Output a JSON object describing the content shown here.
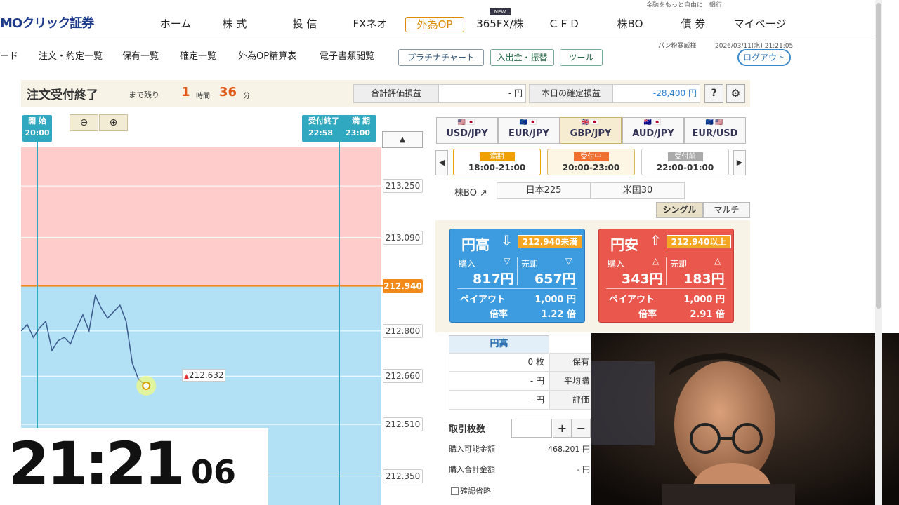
{
  "top_right_text": "金融をもっと自由に　銀行",
  "nav": {
    "logo": "MOクリック証券",
    "items": [
      "ホーム",
      "株 式",
      "投 信",
      "FXネオ",
      "外為OP",
      "365FX/株",
      "ＣＦＤ",
      "株BO",
      "債 券",
      "マイページ"
    ],
    "new_badge": "NEW"
  },
  "subnav": {
    "items": [
      "ード",
      "注文・約定一覧",
      "保有一覧",
      "確定一覧",
      "外為OP精算表",
      "電子書類閲覧"
    ],
    "buttons": [
      "プラチナチャート",
      "入出金・振替",
      "ツール"
    ],
    "user": "パン粉暴威様",
    "datetime": "2026/03/11(水) 21:21:05",
    "logout": "ログアウト"
  },
  "header": {
    "status": "注文受付終了",
    "remaining_label": "まで残り",
    "hours": "1",
    "hours_unit": "時間",
    "minutes": "36",
    "minutes_unit": "分",
    "pl_label": "合計評価損益",
    "pl_value": "- 円",
    "confirmed_label": "本日の確定損益",
    "confirmed_value": "-28,400 円",
    "help": "?"
  },
  "chart": {
    "start_label": "開 始",
    "start_time": "20:00",
    "close_label": "受付終了",
    "close_time": "22:58",
    "expiry_label": "満 期",
    "expiry_time": "23:00",
    "current_price": "212.632",
    "strike": "212.940"
  },
  "chart_data": {
    "type": "line",
    "strike": 212.94,
    "y_ticks": [
      "213.250",
      "213.090",
      "212.940",
      "212.800",
      "212.660",
      "212.510",
      "212.350"
    ],
    "ylim": [
      212.26,
      213.37
    ],
    "x": [
      "20:00",
      "20:04",
      "20:08",
      "20:12",
      "20:16",
      "20:20",
      "20:24",
      "20:28",
      "20:32",
      "20:36",
      "20:40",
      "20:44",
      "20:48",
      "20:52",
      "20:56",
      "21:00",
      "21:04",
      "21:08",
      "21:12",
      "21:16",
      "21:21"
    ],
    "y": [
      212.8,
      212.82,
      212.78,
      212.81,
      212.83,
      212.74,
      212.77,
      212.78,
      212.76,
      212.81,
      212.85,
      212.8,
      212.91,
      212.87,
      212.84,
      212.86,
      212.88,
      212.83,
      212.7,
      212.65,
      212.63
    ]
  },
  "time_display": {
    "main": "21:21",
    "seconds": "06"
  },
  "currency_tabs": [
    {
      "flags": "🇺🇸🇯🇵",
      "pair": "USD/JPY"
    },
    {
      "flags": "🇪🇺🇯🇵",
      "pair": "EUR/JPY"
    },
    {
      "flags": "🇬🇧🇯🇵",
      "pair": "GBP/JPY"
    },
    {
      "flags": "🇦🇺🇯🇵",
      "pair": "AUD/JPY"
    },
    {
      "flags": "🇪🇺🇺🇸",
      "pair": "EUR/USD"
    }
  ],
  "sessions": [
    {
      "tag": "満期",
      "time": "18:00-21:00",
      "tag_color": "#f0a000"
    },
    {
      "tag": "受付中",
      "time": "20:00-23:00",
      "tag_color": "#f07030"
    },
    {
      "tag": "受付前",
      "time": "22:00-01:00",
      "tag_color": "#aaaaaa"
    }
  ],
  "kabubo": {
    "label": "株BO ↗",
    "markets": [
      "日本225",
      "米国30"
    ]
  },
  "mode": {
    "single": "シングル",
    "multi": "マルチ"
  },
  "cards": {
    "high": {
      "title": "円高",
      "arrow": "⇩",
      "strike": "212.940未満",
      "buy_label": "購入",
      "sell_label": "売却",
      "buy": "817円",
      "sell": "657円",
      "payout_label": "ペイアウト",
      "payout": "1,000 円",
      "rate_label": "倍率",
      "rate": "1.22 倍"
    },
    "low": {
      "title": "円安",
      "arrow": "⇧",
      "strike": "212.940以上",
      "buy_label": "購入",
      "sell_label": "売却",
      "buy": "343円",
      "sell": "183円",
      "payout_label": "ペイアウト",
      "payout": "1,000 円",
      "rate_label": "倍率",
      "rate": "2.91 倍"
    }
  },
  "position": {
    "head": "円高",
    "rows": [
      {
        "value": "0 枚",
        "label": "保有"
      },
      {
        "value": "- 円",
        "label": "平均購"
      },
      {
        "value": "- 円",
        "label": "評価"
      }
    ]
  },
  "order": {
    "qty_label": "取引枚数",
    "plus": "+",
    "minus": "−",
    "available_label": "購入可能金額",
    "available": "468,201 円",
    "total_label": "購入合計金額",
    "total": "- 円",
    "skip_confirm": "確認省略"
  },
  "colors": {
    "above": "#ffcccc",
    "below": "#b2e0f5",
    "strike_line": "#f28a1a",
    "line": "#3a5a8c",
    "blue_card": "#3d9be0",
    "red_card": "#e9574d"
  }
}
